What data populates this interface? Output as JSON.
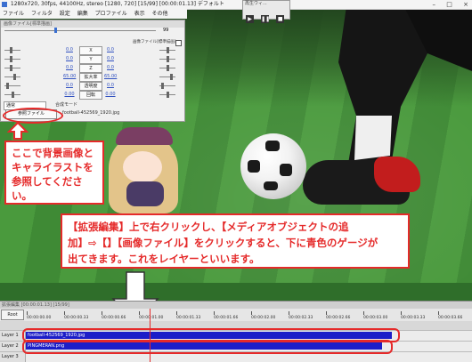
{
  "window": {
    "title": "1280x720, 30fps, 44100Hz, stereo [1280, 720] [15/99] [00:00:01.13] デフォルト",
    "menu": [
      "ファイル",
      "フィルタ",
      "設定",
      "編集",
      "プロファイル",
      "表示",
      "その他"
    ],
    "controls": [
      "–",
      "□",
      "×"
    ]
  },
  "playback": {
    "title": "再生ウィ...",
    "buttons": [
      "▶",
      "❚❚",
      "■"
    ]
  },
  "dialog": {
    "title": "画像ファイル[標準描画]",
    "frame_end": "99",
    "rows": [
      {
        "left": "0.0",
        "label": "X",
        "right": "0.0"
      },
      {
        "left": "0.0",
        "label": "Y",
        "right": "0.0"
      },
      {
        "left": "0.0",
        "label": "Z",
        "right": "0.0"
      },
      {
        "left": "65.00",
        "label": "拡大率",
        "right": "65.00"
      },
      {
        "left": "0.0",
        "label": "透明度",
        "right": "0.0"
      },
      {
        "left": "0.00",
        "label": "回転",
        "right": "0.00"
      }
    ],
    "blend_mode": "通常",
    "blend_label": "合成モード",
    "ref_button": "参照ファイル",
    "file_name": "football-452569_1920.jpg",
    "subobj_label": "画像ファイル[標準描画]"
  },
  "callout1": {
    "lines": [
      "ここで背景画像と",
      "キャライラストを",
      "参照してください。"
    ]
  },
  "callout2": {
    "lines": [
      "【拡張編集】上で右クリックし、【メディアオブジェクトの追",
      "加】⇨【】【画像ファイル】をクリックすると、下に青色のゲージが",
      "出てきます。これをレイヤーといいます。"
    ]
  },
  "timeline": {
    "title": "拡張編集 [00:00:01.13] [15/99]",
    "root_label": "Root",
    "ticks": [
      "00:00:00.00",
      "00:00:00.33",
      "00:00:00.66",
      "00:00:01.00",
      "00:00:01.33",
      "00:00:01.66",
      "00:00:02.00",
      "00:00:02.33",
      "00:00:02.66",
      "00:00:03.00",
      "00:00:03.33",
      "00:00:03.66"
    ],
    "layers": [
      {
        "label": "Layer 1",
        "clip": "football-452569_1920.jpg"
      },
      {
        "label": "Layer 2",
        "clip": "PINGMERAN.png"
      },
      {
        "label": "Layer 3",
        "clip": ""
      }
    ]
  },
  "colors": {
    "accent_red": "#e52a2a",
    "layer_blue": "#1c1ec8"
  }
}
